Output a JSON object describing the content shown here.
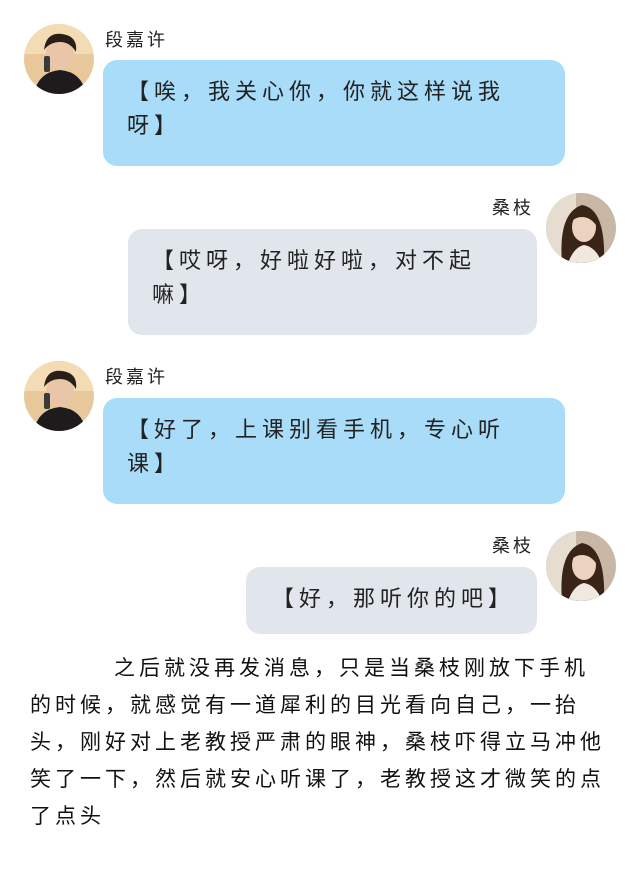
{
  "messages": [
    {
      "sender": "段嘉许",
      "side": "left",
      "text": "【唉，我关心你，你就这样说我呀】"
    },
    {
      "sender": "桑枝",
      "side": "right",
      "text": "【哎呀，好啦好啦，对不起嘛】"
    },
    {
      "sender": "段嘉许",
      "side": "left",
      "text": "【好了，上课别看手机，专心听课】"
    },
    {
      "sender": "桑枝",
      "side": "right",
      "text": "【好，那听你的吧】"
    }
  ],
  "narrative": "之后就没再发消息，只是当桑枝刚放下手机的时候，就感觉有一道犀利的目光看向自己，一抬头，刚好对上老教授严肃的眼神，桑枝吓得立马冲他笑了一下，然后就安心听课了，老教授这才微笑的点了点头",
  "colors": {
    "left_bubble": "#a8dcf8",
    "right_bubble": "#e1e5ec"
  }
}
